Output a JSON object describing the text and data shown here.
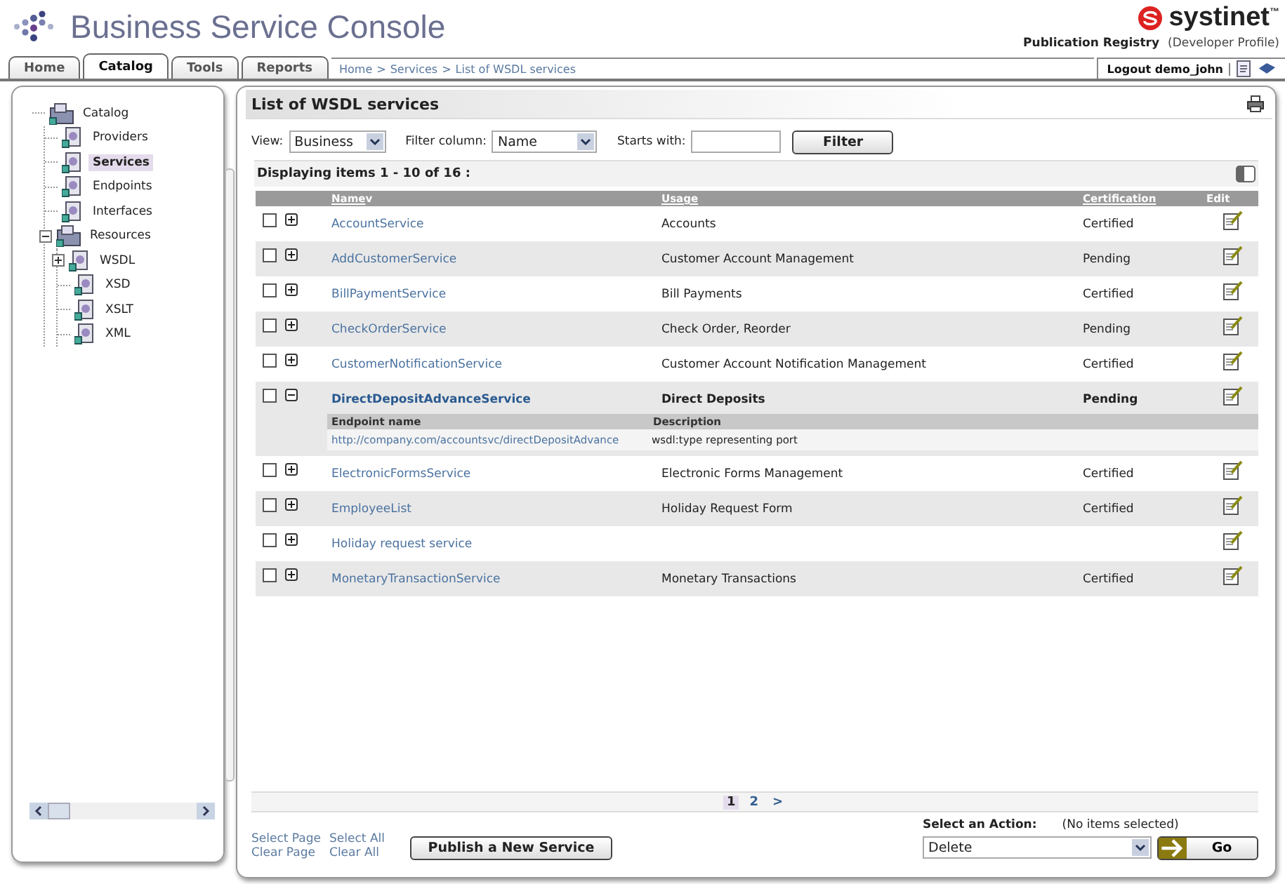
{
  "header": {
    "title": "Business Service Console",
    "brand": "systinet",
    "trademark": "™",
    "registry": "Publication Registry",
    "profile": "(Developer Profile)"
  },
  "tabs": [
    {
      "label": "Home",
      "selected": false
    },
    {
      "label": "Catalog",
      "selected": true
    },
    {
      "label": "Tools",
      "selected": false
    },
    {
      "label": "Reports",
      "selected": false
    }
  ],
  "breadcrumb": {
    "items": [
      "Home",
      "Services",
      "List of WSDL services"
    ],
    "separator": ">"
  },
  "user": {
    "logout": "Logout demo_john"
  },
  "tree": [
    {
      "label": "Catalog",
      "selected": false,
      "children": [
        {
          "label": "Providers",
          "selected": false
        },
        {
          "label": "Services",
          "selected": true
        },
        {
          "label": "Endpoints",
          "selected": false
        },
        {
          "label": "Interfaces",
          "selected": false
        },
        {
          "label": "Resources",
          "selected": false,
          "expanded": true,
          "children": [
            {
              "label": "WSDL",
              "selected": false,
              "expanded": false
            },
            {
              "label": "XSD",
              "selected": false
            },
            {
              "label": "XSLT",
              "selected": false
            },
            {
              "label": "XML",
              "selected": false
            }
          ]
        }
      ]
    }
  ],
  "panel": {
    "title": "List of WSDL services"
  },
  "filters": {
    "view_label": "View:",
    "view_value": "Business",
    "column_label": "Filter column:",
    "column_value": "Name",
    "starts_label": "Starts with:",
    "filter_button": "Filter"
  },
  "displaying": "Displaying items 1 - 10 of 16 :",
  "columns": [
    {
      "label": "Name",
      "sort_mark": "v"
    },
    {
      "label": "Usage"
    },
    {
      "label": "Certification"
    },
    {
      "label": "Edit"
    }
  ],
  "endpoint_columns": [
    "Endpoint name",
    "Description"
  ],
  "rows": [
    {
      "name": "AccountService",
      "usage": "Accounts",
      "certification": "Certified",
      "checked": false,
      "expanded": false
    },
    {
      "name": "AddCustomerService",
      "usage": "Customer Account Management",
      "certification": "Pending",
      "checked": false,
      "expanded": false
    },
    {
      "name": "BillPaymentService",
      "usage": "Bill Payments",
      "certification": "Certified",
      "checked": false,
      "expanded": false
    },
    {
      "name": "CheckOrderService",
      "usage": "Check Order, Reorder",
      "certification": "Pending",
      "checked": false,
      "expanded": false
    },
    {
      "name": "CustomerNotificationService",
      "usage": "Customer Account Notification Management",
      "certification": "Certified",
      "checked": false,
      "expanded": false
    },
    {
      "name": "DirectDepositAdvanceService",
      "usage": "Direct Deposits",
      "certification": "Pending",
      "checked": false,
      "expanded": true,
      "endpoints": [
        {
          "name": "http://company.com/accountsvc/directDepositAdvance",
          "description": "wsdl:type representing port"
        }
      ]
    },
    {
      "name": "ElectronicFormsService",
      "usage": "Electronic Forms Management",
      "certification": "Certified",
      "checked": false,
      "expanded": false
    },
    {
      "name": "EmployeeList",
      "usage": "Holiday Request Form",
      "certification": "Certified",
      "checked": false,
      "expanded": false
    },
    {
      "name": "Holiday request service",
      "checked": false,
      "expanded": false
    },
    {
      "name": "MonetaryTransactionService",
      "usage": "Monetary Transactions",
      "certification": "Certified",
      "checked": false,
      "expanded": false
    }
  ],
  "pagination": {
    "pages": [
      {
        "label": "1",
        "selected": true
      },
      {
        "label": "2",
        "selected": false
      }
    ],
    "next": ">"
  },
  "footer": {
    "links": [
      "Select Page",
      "Select All",
      "Clear Page",
      "Clear All"
    ],
    "publish_button": "Publish a New Service",
    "action_label": "Select an Action:",
    "action_note": "(No items selected)",
    "action_value": "Delete",
    "go_button": "Go"
  }
}
